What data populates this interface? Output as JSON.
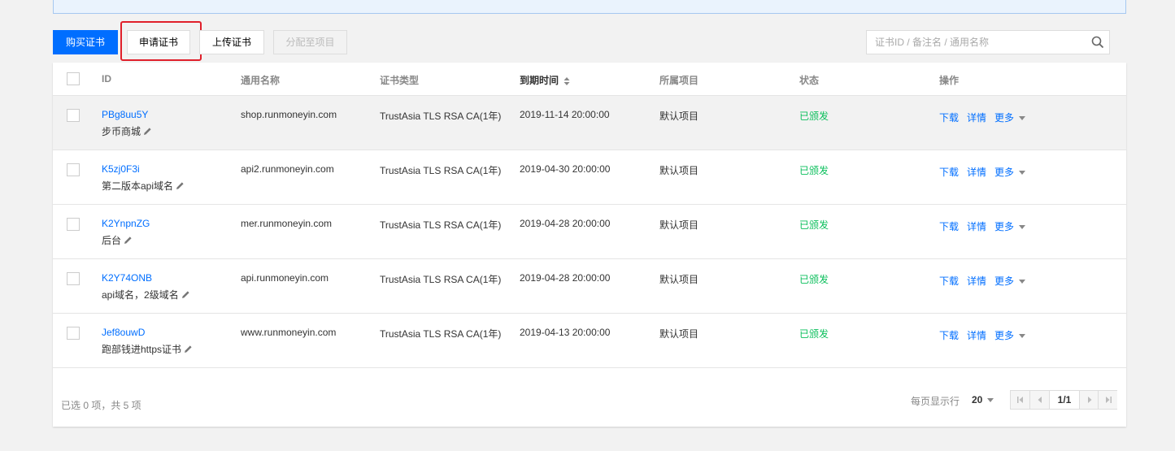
{
  "toolbar": {
    "buy_label": "购买证书",
    "apply_label": "申请证书",
    "upload_label": "上传证书",
    "assign_label": "分配至项目"
  },
  "search": {
    "placeholder": "证书ID / 备注名 / 通用名称"
  },
  "table": {
    "headers": {
      "id": "ID",
      "common_name": "通用名称",
      "cert_type": "证书类型",
      "expire": "到期时间",
      "project": "所属项目",
      "status": "状态",
      "ops": "操作"
    },
    "rows": [
      {
        "id": "PBg8uu5Y",
        "alias": "步币商城",
        "common_name": "shop.runmoneyin.com",
        "cert_type": "TrustAsia TLS RSA CA(1年)",
        "expire": "2019-11-14 20:00:00",
        "project": "默认项目",
        "status": "已颁发"
      },
      {
        "id": "K5zj0F3i",
        "alias": "第二版本api域名",
        "common_name": "api2.runmoneyin.com",
        "cert_type": "TrustAsia TLS RSA CA(1年)",
        "expire": "2019-04-30 20:00:00",
        "project": "默认项目",
        "status": "已颁发"
      },
      {
        "id": "K2YnpnZG",
        "alias": "后台",
        "common_name": "mer.runmoneyin.com",
        "cert_type": "TrustAsia TLS RSA CA(1年)",
        "expire": "2019-04-28 20:00:00",
        "project": "默认项目",
        "status": "已颁发"
      },
      {
        "id": "K2Y74ONB",
        "alias": "api域名，2级域名",
        "common_name": "api.runmoneyin.com",
        "cert_type": "TrustAsia TLS RSA CA(1年)",
        "expire": "2019-04-28 20:00:00",
        "project": "默认项目",
        "status": "已颁发"
      },
      {
        "id": "Jef8ouwD",
        "alias": "跑部钱进https证书",
        "common_name": "www.runmoneyin.com",
        "cert_type": "TrustAsia TLS RSA CA(1年)",
        "expire": "2019-04-13 20:00:00",
        "project": "默认项目",
        "status": "已颁发"
      }
    ],
    "ops": {
      "download": "下载",
      "detail": "详情",
      "more": "更多"
    }
  },
  "footer": {
    "selection": "已选 0 项，共 5 项",
    "page_size_label": "每页显示行",
    "page_size": "20",
    "page_indicator": "1/1"
  },
  "colors": {
    "primary": "#006eff",
    "success": "#0abf5b",
    "highlight": "#e0202b"
  }
}
